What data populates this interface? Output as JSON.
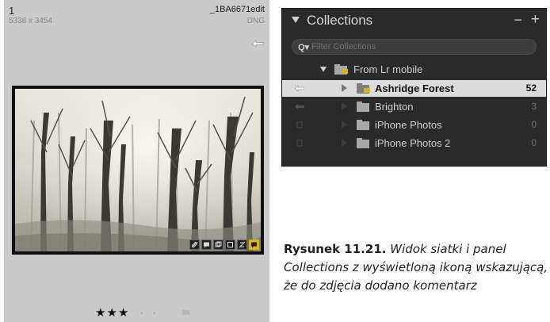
{
  "grid_cell": {
    "index": "1",
    "dimensions": "5338 x 3454",
    "filename": "_1BA6671edit",
    "filetype": "DNG",
    "rating_stars": "★★★",
    "rating_dots": "· ·",
    "thumbnail_badges": [
      "develop-settings-icon",
      "comment-icon",
      "collection-icon",
      "crop-icon",
      "metadata-icon",
      "comment-badge-icon"
    ]
  },
  "collections_panel": {
    "title": "Collections",
    "minus": "−",
    "plus": "+",
    "filter_placeholder": "Filter Collections",
    "set": {
      "label": "From Lr mobile"
    },
    "items": [
      {
        "label": "Ashridge Forest",
        "count": "52",
        "selected": true
      },
      {
        "label": "Brighton",
        "count": "3",
        "selected": false
      },
      {
        "label": "iPhone Photos",
        "count": "0",
        "selected": false
      },
      {
        "label": "iPhone Photos 2",
        "count": "0",
        "selected": false
      }
    ]
  },
  "caption": {
    "lead": "Rysunek 11.21.",
    "body": " Widok siatki i panel Collections z wyświetloną ikoną wskazującą, że do zdjęcia dodano komentarz"
  },
  "colors": {
    "panel_bg": "#2a2a2a",
    "selected_row": "#dcdcdc",
    "comment_badge": "#d7b329",
    "folder_icon": "#a9a9a9"
  }
}
